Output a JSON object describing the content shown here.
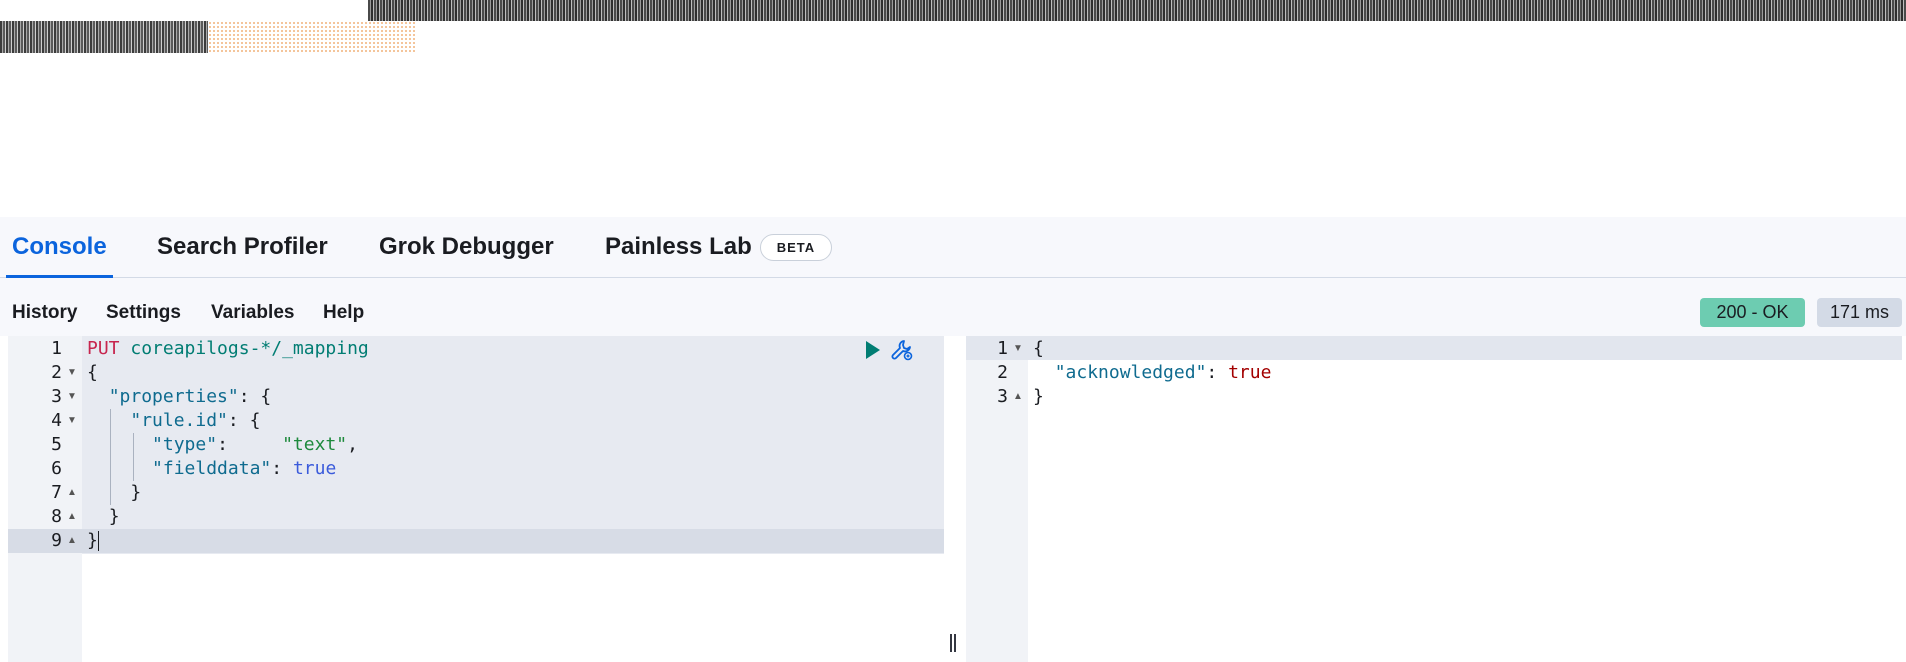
{
  "tabs": [
    {
      "label": "Console"
    },
    {
      "label": "Search Profiler"
    },
    {
      "label": "Grok Debugger"
    },
    {
      "label": "Painless Lab",
      "badge": "BETA"
    }
  ],
  "toolbar": {
    "history": "History",
    "settings": "Settings",
    "variables": "Variables",
    "help": "Help"
  },
  "status": {
    "code": "200 - OK",
    "time": "171 ms"
  },
  "request": {
    "line_numbers": [
      "1",
      "2",
      "3",
      "4",
      "5",
      "6",
      "7",
      "8",
      "9"
    ],
    "method": "PUT",
    "url": "coreapilogs-*/_mapping",
    "lines": {
      "l2": "{",
      "l3_key": "\"properties\"",
      "l3_rest": ": {",
      "l4_key": "\"rule.id\"",
      "l4_rest": ": {",
      "l5_key": "\"type\"",
      "l5_sep": ":     ",
      "l5_val": "\"text\"",
      "l5_end": ",",
      "l6_key": "\"fielddata\"",
      "l6_sep": ": ",
      "l6_val": "true",
      "l7": "}",
      "l8": "}",
      "l9": "}"
    }
  },
  "response": {
    "line_numbers": [
      "1",
      "2",
      "3"
    ],
    "l1": "{",
    "l2_key": "\"acknowledged\"",
    "l2_sep": ": ",
    "l2_val": "true",
    "l3": "}"
  },
  "icons": {
    "run": "play-icon",
    "wrench": "wrench-icon"
  },
  "colors": {
    "accent": "#0b64dd",
    "ok_badge": "#6dccb1",
    "time_badge": "#d3dae6"
  }
}
